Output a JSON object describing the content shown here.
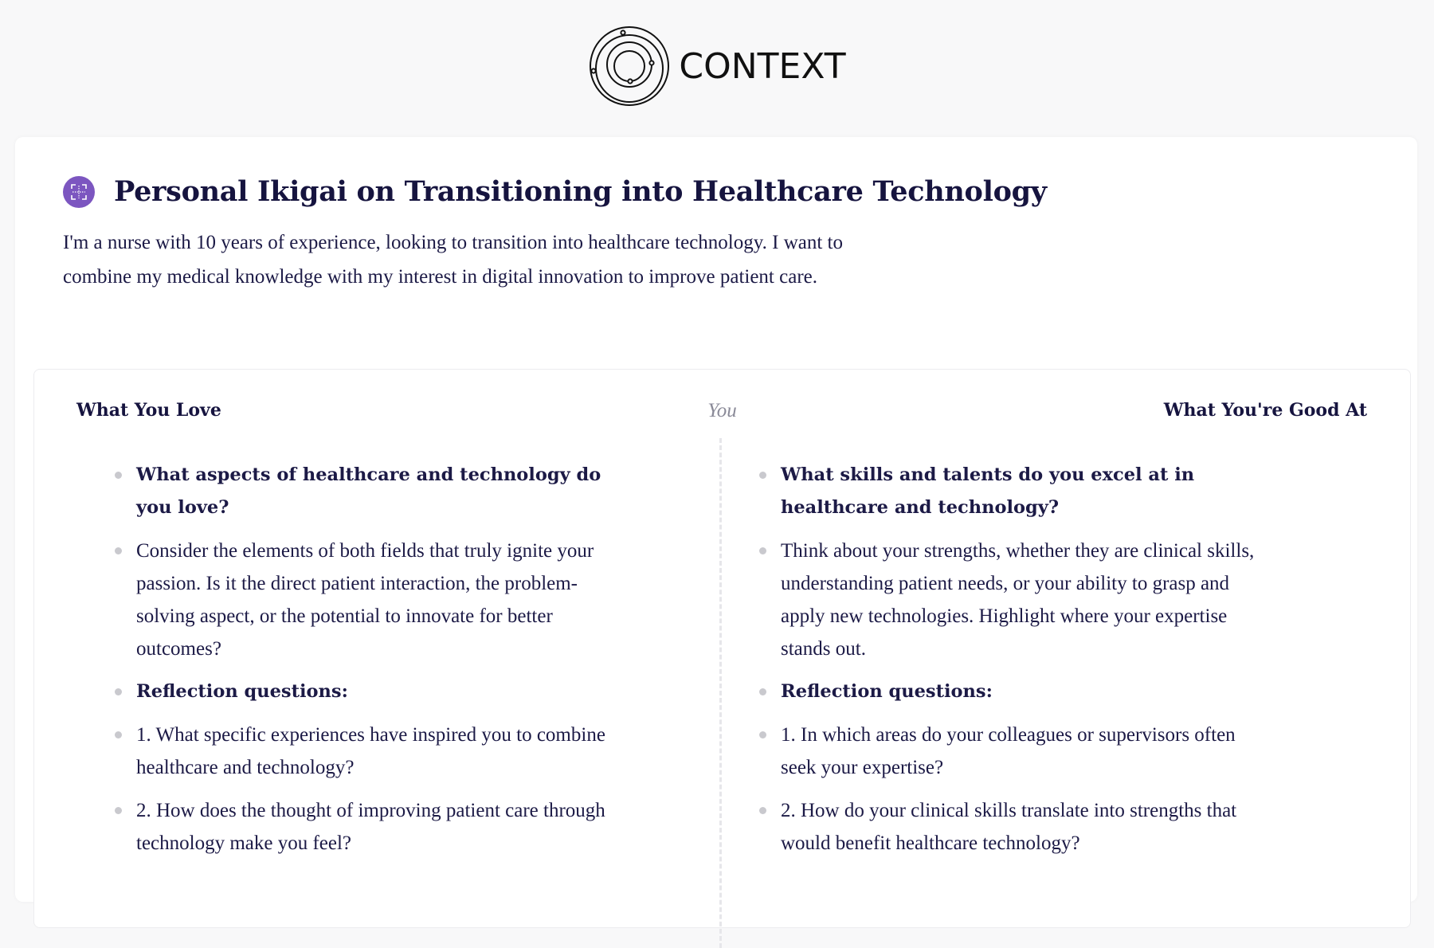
{
  "brand": {
    "name": "CONTEXT",
    "logo_icon": "concentric-orbits-icon"
  },
  "header": {
    "title": "Personal Ikigai on Transitioning into Healthcare Technology",
    "title_icon": "frame-grid-icon",
    "title_icon_color": "#7c56c0",
    "description": "I'm a nurse with 10 years of experience, looking to transition into healthcare technology. I want to combine my medical knowledge with my interest in digital innovation to improve patient care."
  },
  "ikigai": {
    "center_label": "You",
    "left": {
      "heading": "What You Love",
      "items": [
        {
          "text": "What aspects of healthcare and technology do you love?",
          "bold": true
        },
        {
          "text": "Consider the elements of both fields that truly ignite your passion. Is it the direct patient interaction, the problem-solving aspect, or the potential to innovate for better outcomes?",
          "bold": false
        },
        {
          "text": "Reflection questions:",
          "bold": true
        },
        {
          "text": "1. What specific experiences have inspired you to combine healthcare and technology?",
          "bold": false
        },
        {
          "text": "2. How does the thought of improving patient care through technology make you feel?",
          "bold": false
        }
      ]
    },
    "right": {
      "heading": "What You're Good At",
      "items": [
        {
          "text": "What skills and talents do you excel at in healthcare and technology?",
          "bold": true
        },
        {
          "text": "Think about your strengths, whether they are clinical skills, understanding patient needs, or your ability to grasp and apply new technologies. Highlight where your expertise stands out.",
          "bold": false
        },
        {
          "text": "Reflection questions:",
          "bold": true
        },
        {
          "text": "1. In which areas do your colleagues or supervisors often seek your expertise?",
          "bold": false
        },
        {
          "text": "2. How do your clinical skills translate into strengths that would benefit healthcare technology?",
          "bold": false
        }
      ]
    }
  }
}
